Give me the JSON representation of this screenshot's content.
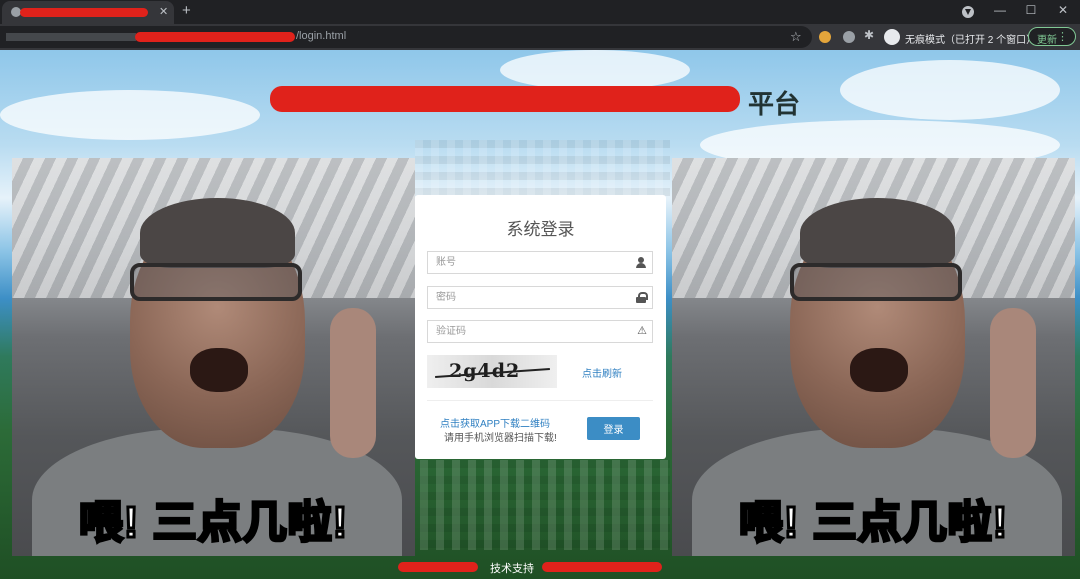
{
  "browser": {
    "tab_title": "",
    "url_visible": "/login.html",
    "incognito_label": "无痕模式（已打开 2 个窗口）",
    "update_label": "更新",
    "icons": {
      "new_tab": "+",
      "tab_close": "✕",
      "star": "☆",
      "menu": "⋮",
      "minimize": "—",
      "maximize": "☐",
      "close": "✕"
    }
  },
  "page": {
    "title_visible": "平台",
    "login": {
      "heading": "系统登录",
      "username_placeholder": "账号",
      "password_placeholder": "密码",
      "captcha_placeholder": "验证码",
      "captcha_text": "2g4d2",
      "refresh_label": "点击刷新",
      "app_download_link": "点击获取APP下载二维码",
      "app_download_hint": "请用手机浏览器扫描下载!",
      "submit_label": "登录",
      "warning_icon": "⚠"
    },
    "meme_caption": "喂! 三点几啦!",
    "footer_text": "技术支持"
  }
}
